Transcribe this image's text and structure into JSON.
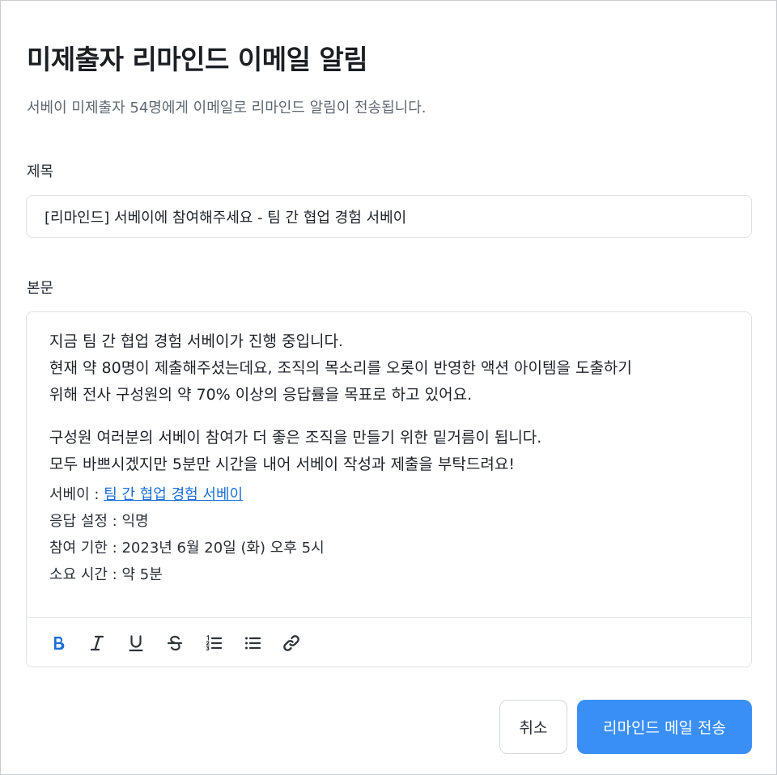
{
  "dialog": {
    "title": "미제출자 리마인드 이메일 알림",
    "subtitle": "서베이 미제출자 54명에게 이메일로 리마인드 알림이 전송됩니다."
  },
  "subject": {
    "label": "제목",
    "value": "[리마인드] 서베이에 참여해주세요 - 팀 간 협업 경험 서베이"
  },
  "body": {
    "label": "본문",
    "paragraph1": [
      "지금 팀 간 협업 경험 서베이가 진행 중입니다.",
      "현재 약 80명이 제출해주셨는데요, 조직의 목소리를 오롯이 반영한 액션 아이템을 도출하기",
      "위해 전사 구성원의 약 70% 이상의 응답률을 목표로 하고 있어요."
    ],
    "paragraph2": [
      "구성원 여러분의 서베이 참여가 더 좋은 조직을 만들기 위한 밑거름이 됩니다.",
      "모두 바쁘시겠지만 5분만 시간을 내어 서베이 작성과 제출을 부탁드려요!"
    ],
    "survey_label": "서베이 : ",
    "survey_link": "팀 간 협업 경험 서베이",
    "response_setting": "응답 설정 : 익명",
    "deadline": "참여 기한 : 2023년 6월 20일 (화) 오후 5시",
    "duration": "소요 시간 : 약 5분"
  },
  "toolbar": {
    "icons": [
      "bold-icon",
      "italic-icon",
      "underline-icon",
      "strikethrough-icon",
      "ordered-list-icon",
      "bullet-list-icon",
      "link-icon"
    ],
    "active_color": "#1a6fd8"
  },
  "actions": {
    "cancel_label": "취소",
    "send_label": "리마인드 메일 전송",
    "send_color": "#3a8ff6"
  }
}
